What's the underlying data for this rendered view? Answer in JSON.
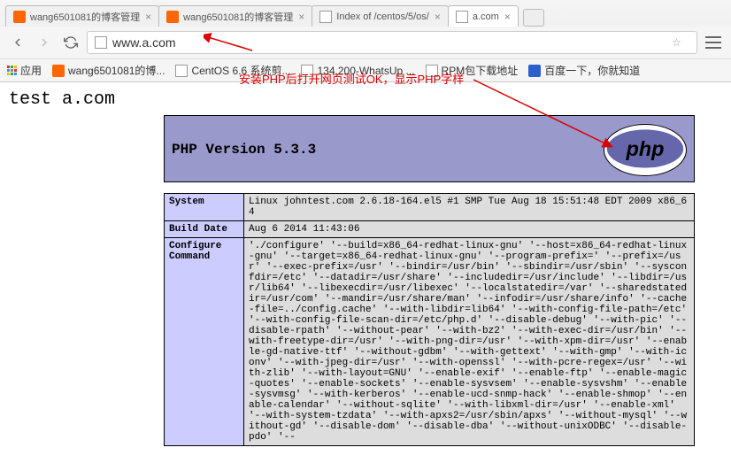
{
  "tabs": [
    {
      "title": "wang6501081的博客管理",
      "favicon": "orange"
    },
    {
      "title": "wang6501081的博客管理",
      "favicon": "orange"
    },
    {
      "title": "Index of /centos/5/os/",
      "favicon": "doc"
    },
    {
      "title": "a.com",
      "favicon": "doc",
      "active": true
    }
  ],
  "url": "www.a.com",
  "bookmarks": {
    "apps": "应用",
    "items": [
      {
        "label": "wang6501081的博...",
        "icon": "orange"
      },
      {
        "label": "CentOS 6.6 系统剪...",
        "icon": "doc"
      },
      {
        "label": "134.200-WhatsUp ...",
        "icon": "doc"
      },
      {
        "label": "RPM包下载地址",
        "icon": "doc"
      },
      {
        "label": "百度一下，你就知道",
        "icon": "blue"
      }
    ]
  },
  "annotation_text": "安装PHP后打开网页测试OK，显示PHP字样",
  "page_title_text": "test a.com",
  "php_version": "PHP Version 5.3.3",
  "php_logo_text": "php",
  "info_rows": [
    {
      "key": "System",
      "val": "Linux johntest.com 2.6.18-164.el5 #1 SMP Tue Aug 18 15:51:48 EDT 2009 x86_64"
    },
    {
      "key": "Build Date",
      "val": "Aug 6 2014 11:43:06"
    },
    {
      "key": "Configure Command",
      "val": "'./configure' '--build=x86_64-redhat-linux-gnu' '--host=x86_64-redhat-linux-gnu' '--target=x86_64-redhat-linux-gnu' '--program-prefix=' '--prefix=/usr' '--exec-prefix=/usr' '--bindir=/usr/bin' '--sbindir=/usr/sbin' '--sysconfdir=/etc' '--datadir=/usr/share' '--includedir=/usr/include' '--libdir=/usr/lib64' '--libexecdir=/usr/libexec' '--localstatedir=/var' '--sharedstatedir=/usr/com' '--mandir=/usr/share/man' '--infodir=/usr/share/info' '--cache-file=../config.cache' '--with-libdir=lib64' '--with-config-file-path=/etc' '--with-config-file-scan-dir=/etc/php.d' '--disable-debug' '--with-pic' '--disable-rpath' '--without-pear' '--with-bz2' '--with-exec-dir=/usr/bin' '--with-freetype-dir=/usr' '--with-png-dir=/usr' '--with-xpm-dir=/usr' '--enable-gd-native-ttf' '--without-gdbm' '--with-gettext' '--with-gmp' '--with-iconv' '--with-jpeg-dir=/usr' '--with-openssl' '--with-pcre-regex=/usr' '--with-zlib' '--with-layout=GNU' '--enable-exif' '--enable-ftp' '--enable-magic-quotes' '--enable-sockets' '--enable-sysvsem' '--enable-sysvshm' '--enable-sysvmsg' '--with-kerberos' '--enable-ucd-snmp-hack' '--enable-shmop' '--enable-calendar' '--without-sqlite' '--with-libxml-dir=/usr' '--enable-xml' '--with-system-tzdata' '--with-apxs2=/usr/sbin/apxs' '--without-mysql' '--without-gd' '--disable-dom' '--disable-dba' '--without-unixODBC' '--disable-pdo' '--"
    }
  ]
}
